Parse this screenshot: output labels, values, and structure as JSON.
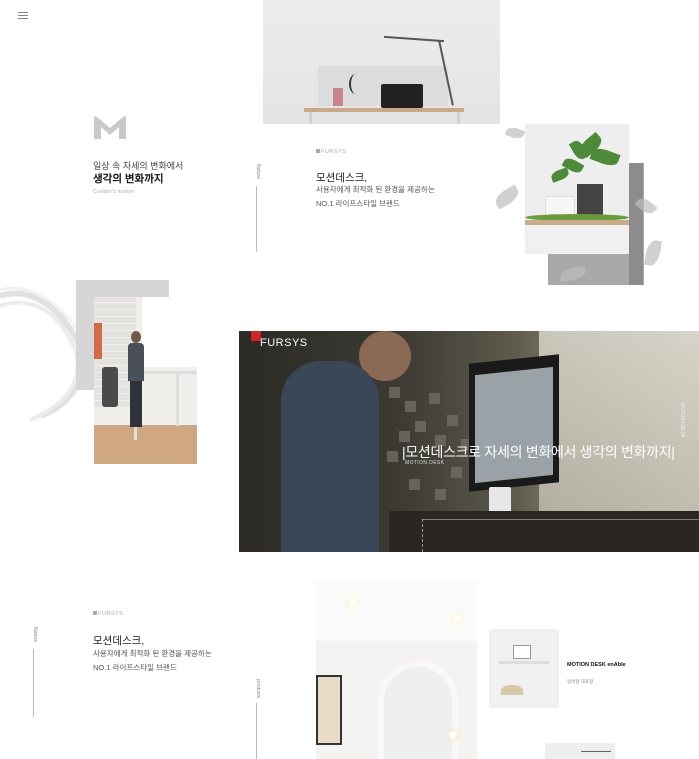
{
  "header": {
    "menu_icon": "hamburger-menu-icon",
    "search_icon": "search-icon"
  },
  "brand": {
    "logo_icon": "m-logo-icon",
    "tagline_line1": "일상 속 자세의 변화에서",
    "tagline_line2": "생각의 변화까지",
    "tagline_en": "Creator's motion"
  },
  "section_nature": {
    "vertical_label": "Nature",
    "brand_label": "FURSYS",
    "title": "모션데스크,",
    "sub_line1": "사용자에게 최적화 된 환경을 제공하는",
    "sub_line2": "NO.1 라이프스타일 브랜드"
  },
  "banner": {
    "brand": "FURSYS",
    "headline": "|모션데스크로 자세의 변화에서 생각의 변화까지|",
    "small_text": "MOTION DESK",
    "vertical_text": "MOTION DESK"
  },
  "section_bottom": {
    "vertical_label": "Nature",
    "brand_label": "FURSYS",
    "title": "모션데스크,",
    "sub_line1": "사용자에게 최적화 된 환경을 제공하는",
    "sub_line2": "NO.1 라이프스타일 브랜드",
    "vertical_label2": "products"
  },
  "product": {
    "title": "MOTION DESK enAble",
    "sub": "일바형 대표형"
  },
  "colors": {
    "accent_red": "#d2232a",
    "text_dark": "#111111",
    "text_muted": "#888888"
  }
}
